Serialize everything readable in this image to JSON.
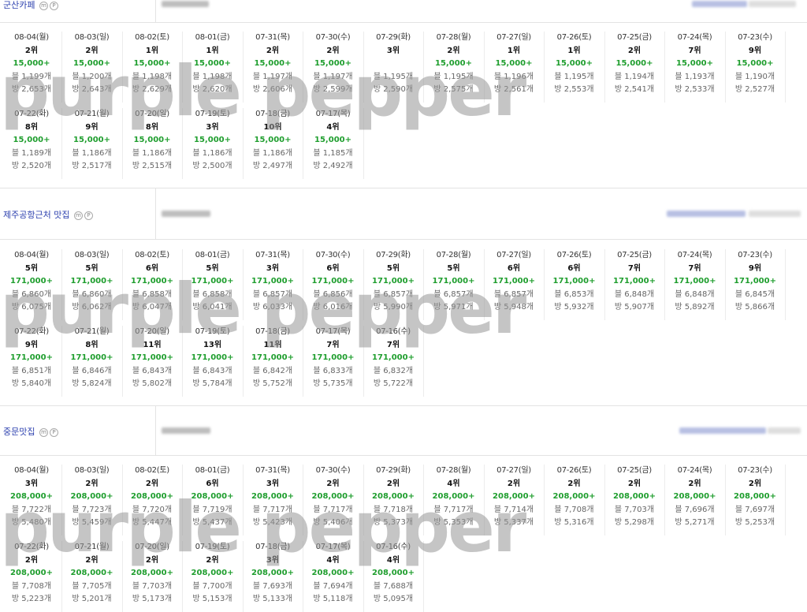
{
  "keywords": [
    {
      "name": "군산카페",
      "badges": [
        "m",
        "P"
      ],
      "row1": [
        {
          "date": "08-04(월)",
          "rank": "2위",
          "volume": "15,000+",
          "blog": "블 1,199개",
          "place": "방 2,653개"
        },
        {
          "date": "08-03(일)",
          "rank": "2위",
          "volume": "15,000+",
          "blog": "블 1,200개",
          "place": "방 2,643개"
        },
        {
          "date": "08-02(토)",
          "rank": "1위",
          "volume": "15,000+",
          "blog": "블 1,198개",
          "place": "방 2,629개"
        },
        {
          "date": "08-01(금)",
          "rank": "1위",
          "volume": "15,000+",
          "blog": "블 1,198개",
          "place": "방 2,620개"
        },
        {
          "date": "07-31(목)",
          "rank": "2위",
          "volume": "15,000+",
          "blog": "블 1,197개",
          "place": "방 2,606개"
        },
        {
          "date": "07-30(수)",
          "rank": "2위",
          "volume": "15,000+",
          "blog": "블 1,197개",
          "place": "방 2,599개"
        },
        {
          "date": "07-29(화)",
          "rank": "3위",
          "volume": "",
          "blog": "블 1,195개",
          "place": "방 2,590개"
        },
        {
          "date": "07-28(월)",
          "rank": "2위",
          "volume": "15,000+",
          "blog": "블 1,195개",
          "place": "방 2,575개"
        },
        {
          "date": "07-27(일)",
          "rank": "1위",
          "volume": "15,000+",
          "blog": "블 1,196개",
          "place": "방 2,561개"
        },
        {
          "date": "07-26(토)",
          "rank": "1위",
          "volume": "15,000+",
          "blog": "블 1,195개",
          "place": "방 2,553개"
        },
        {
          "date": "07-25(금)",
          "rank": "2위",
          "volume": "15,000+",
          "blog": "블 1,194개",
          "place": "방 2,541개"
        },
        {
          "date": "07-24(목)",
          "rank": "7위",
          "volume": "15,000+",
          "blog": "블 1,193개",
          "place": "방 2,533개"
        },
        {
          "date": "07-23(수)",
          "rank": "9위",
          "volume": "15,000+",
          "blog": "블 1,190개",
          "place": "방 2,527개"
        }
      ],
      "row2": [
        {
          "date": "07-22(화)",
          "rank": "8위",
          "volume": "15,000+",
          "blog": "블 1,189개",
          "place": "방 2,520개"
        },
        {
          "date": "07-21(월)",
          "rank": "9위",
          "volume": "15,000+",
          "blog": "블 1,186개",
          "place": "방 2,517개"
        },
        {
          "date": "07-20(일)",
          "rank": "8위",
          "volume": "15,000+",
          "blog": "블 1,186개",
          "place": "방 2,515개"
        },
        {
          "date": "07-19(토)",
          "rank": "3위",
          "volume": "15,000+",
          "blog": "블 1,186개",
          "place": "방 2,500개"
        },
        {
          "date": "07-18(금)",
          "rank": "10위",
          "volume": "15,000+",
          "blog": "블 1,186개",
          "place": "방 2,497개"
        },
        {
          "date": "07-17(목)",
          "rank": "4위",
          "volume": "15,000+",
          "blog": "블 1,185개",
          "place": "방 2,492개"
        }
      ]
    },
    {
      "name": "제주공항근처 맛집",
      "badges": [
        "m",
        "P"
      ],
      "row1": [
        {
          "date": "08-04(월)",
          "rank": "5위",
          "volume": "171,000+",
          "blog": "블 6,860개",
          "place": "방 6,075개"
        },
        {
          "date": "08-03(일)",
          "rank": "5위",
          "volume": "171,000+",
          "blog": "블 6,860개",
          "place": "방 6,062개"
        },
        {
          "date": "08-02(토)",
          "rank": "6위",
          "volume": "171,000+",
          "blog": "블 6,858개",
          "place": "방 6,047개"
        },
        {
          "date": "08-01(금)",
          "rank": "5위",
          "volume": "171,000+",
          "blog": "블 6,858개",
          "place": "방 6,041개"
        },
        {
          "date": "07-31(목)",
          "rank": "3위",
          "volume": "171,000+",
          "blog": "블 6,857개",
          "place": "방 6,033개"
        },
        {
          "date": "07-30(수)",
          "rank": "6위",
          "volume": "171,000+",
          "blog": "블 6,856개",
          "place": "방 6,016개"
        },
        {
          "date": "07-29(화)",
          "rank": "5위",
          "volume": "171,000+",
          "blog": "블 6,857개",
          "place": "방 5,990개"
        },
        {
          "date": "07-28(월)",
          "rank": "5위",
          "volume": "171,000+",
          "blog": "블 6,857개",
          "place": "방 5,971개"
        },
        {
          "date": "07-27(일)",
          "rank": "6위",
          "volume": "171,000+",
          "blog": "블 6,857개",
          "place": "방 5,948개"
        },
        {
          "date": "07-26(토)",
          "rank": "6위",
          "volume": "171,000+",
          "blog": "블 6,853개",
          "place": "방 5,932개"
        },
        {
          "date": "07-25(금)",
          "rank": "7위",
          "volume": "171,000+",
          "blog": "블 6,848개",
          "place": "방 5,907개"
        },
        {
          "date": "07-24(목)",
          "rank": "7위",
          "volume": "171,000+",
          "blog": "블 6,848개",
          "place": "방 5,892개"
        },
        {
          "date": "07-23(수)",
          "rank": "9위",
          "volume": "171,000+",
          "blog": "블 6,845개",
          "place": "방 5,866개"
        }
      ],
      "row2": [
        {
          "date": "07-22(화)",
          "rank": "9위",
          "volume": "171,000+",
          "blog": "블 6,851개",
          "place": "방 5,840개"
        },
        {
          "date": "07-21(월)",
          "rank": "8위",
          "volume": "171,000+",
          "blog": "블 6,846개",
          "place": "방 5,824개"
        },
        {
          "date": "07-20(일)",
          "rank": "11위",
          "volume": "171,000+",
          "blog": "블 6,843개",
          "place": "방 5,802개"
        },
        {
          "date": "07-19(토)",
          "rank": "13위",
          "volume": "171,000+",
          "blog": "블 6,843개",
          "place": "방 5,784개"
        },
        {
          "date": "07-18(금)",
          "rank": "11위",
          "volume": "171,000+",
          "blog": "블 6,842개",
          "place": "방 5,752개"
        },
        {
          "date": "07-17(목)",
          "rank": "7위",
          "volume": "171,000+",
          "blog": "블 6,833개",
          "place": "방 5,735개"
        },
        {
          "date": "07-16(수)",
          "rank": "7위",
          "volume": "171,000+",
          "blog": "블 6,832개",
          "place": "방 5,722개"
        }
      ]
    },
    {
      "name": "중문맛집",
      "badges": [
        "m",
        "P"
      ],
      "row1": [
        {
          "date": "08-04(월)",
          "rank": "3위",
          "volume": "208,000+",
          "blog": "블 7,722개",
          "place": "방 5,480개"
        },
        {
          "date": "08-03(일)",
          "rank": "2위",
          "volume": "208,000+",
          "blog": "블 7,723개",
          "place": "방 5,459개"
        },
        {
          "date": "08-02(토)",
          "rank": "2위",
          "volume": "208,000+",
          "blog": "블 7,720개",
          "place": "방 5,447개"
        },
        {
          "date": "08-01(금)",
          "rank": "6위",
          "volume": "208,000+",
          "blog": "블 7,719개",
          "place": "방 5,437개"
        },
        {
          "date": "07-31(목)",
          "rank": "3위",
          "volume": "208,000+",
          "blog": "블 7,717개",
          "place": "방 5,423개"
        },
        {
          "date": "07-30(수)",
          "rank": "2위",
          "volume": "208,000+",
          "blog": "블 7,717개",
          "place": "방 5,406개"
        },
        {
          "date": "07-29(화)",
          "rank": "2위",
          "volume": "208,000+",
          "blog": "블 7,718개",
          "place": "방 5,373개"
        },
        {
          "date": "07-28(월)",
          "rank": "4위",
          "volume": "208,000+",
          "blog": "블 7,717개",
          "place": "방 5,353개"
        },
        {
          "date": "07-27(일)",
          "rank": "2위",
          "volume": "208,000+",
          "blog": "블 7,714개",
          "place": "방 5,337개"
        },
        {
          "date": "07-26(토)",
          "rank": "2위",
          "volume": "208,000+",
          "blog": "블 7,708개",
          "place": "방 5,316개"
        },
        {
          "date": "07-25(금)",
          "rank": "2위",
          "volume": "208,000+",
          "blog": "블 7,703개",
          "place": "방 5,298개"
        },
        {
          "date": "07-24(목)",
          "rank": "2위",
          "volume": "208,000+",
          "blog": "블 7,696개",
          "place": "방 5,271개"
        },
        {
          "date": "07-23(수)",
          "rank": "2위",
          "volume": "208,000+",
          "blog": "블 7,697개",
          "place": "방 5,253개"
        }
      ],
      "row2": [
        {
          "date": "07-22(화)",
          "rank": "2위",
          "volume": "208,000+",
          "blog": "블 7,708개",
          "place": "방 5,223개"
        },
        {
          "date": "07-21(월)",
          "rank": "2위",
          "volume": "208,000+",
          "blog": "블 7,705개",
          "place": "방 5,201개"
        },
        {
          "date": "07-20(일)",
          "rank": "2위",
          "volume": "208,000+",
          "blog": "블 7,703개",
          "place": "방 5,173개"
        },
        {
          "date": "07-19(토)",
          "rank": "2위",
          "volume": "208,000+",
          "blog": "블 7,700개",
          "place": "방 5,153개"
        },
        {
          "date": "07-18(금)",
          "rank": "3위",
          "volume": "208,000+",
          "blog": "블 7,693개",
          "place": "방 5,133개"
        },
        {
          "date": "07-17(목)",
          "rank": "4위",
          "volume": "208,000+",
          "blog": "블 7,694개",
          "place": "방 5,118개"
        },
        {
          "date": "07-16(수)",
          "rank": "4위",
          "volume": "208,000+",
          "blog": "블 7,688개",
          "place": "방 5,095개"
        }
      ]
    }
  ],
  "watermark": "purple pepper",
  "colors": {
    "keyword": "#2b3fae",
    "volume": "#1f9e2e",
    "rank": "#111111",
    "muted": "#666666"
  }
}
